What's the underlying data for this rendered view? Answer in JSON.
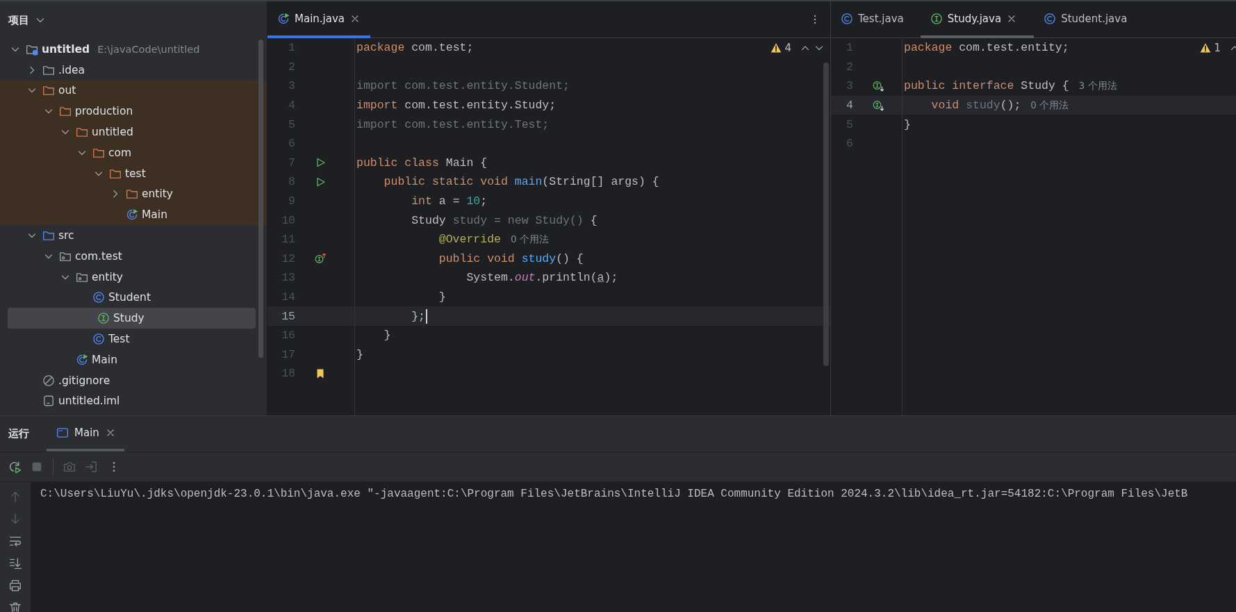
{
  "project": {
    "title": "项目",
    "tree": [
      {
        "label": "untitled",
        "path": "E:\\javaCode\\untitled",
        "kind": "project",
        "expanded": true,
        "selected": false,
        "excluded": false,
        "children": [
          {
            "label": ".idea",
            "kind": "folder",
            "expanded": false,
            "selected": false,
            "excluded": false
          },
          {
            "label": "out",
            "kind": "folder",
            "expanded": true,
            "selected": false,
            "excluded": true,
            "children": [
              {
                "label": "production",
                "kind": "folder",
                "expanded": true,
                "selected": false,
                "excluded": true,
                "children": [
                  {
                    "label": "untitled",
                    "kind": "folder",
                    "expanded": true,
                    "selected": false,
                    "excluded": true,
                    "children": [
                      {
                        "label": "com",
                        "kind": "folder",
                        "expanded": true,
                        "selected": false,
                        "excluded": true,
                        "children": [
                          {
                            "label": "test",
                            "kind": "folder",
                            "expanded": true,
                            "selected": false,
                            "excluded": true,
                            "children": [
                              {
                                "label": "entity",
                                "kind": "folder",
                                "expanded": false,
                                "selected": false,
                                "excluded": true
                              },
                              {
                                "label": "Main",
                                "kind": "main-class",
                                "selected": false,
                                "excluded": true
                              }
                            ]
                          }
                        ]
                      }
                    ]
                  }
                ]
              }
            ]
          },
          {
            "label": "src",
            "kind": "source",
            "expanded": true,
            "selected": false,
            "excluded": false,
            "children": [
              {
                "label": "com.test",
                "kind": "package",
                "expanded": true,
                "selected": false,
                "excluded": false,
                "children": [
                  {
                    "label": "entity",
                    "kind": "package",
                    "expanded": true,
                    "selected": false,
                    "excluded": false,
                    "children": [
                      {
                        "label": "Student",
                        "kind": "class",
                        "selected": false,
                        "excluded": false
                      },
                      {
                        "label": "Study",
                        "kind": "interface",
                        "selected": true,
                        "excluded": false
                      },
                      {
                        "label": "Test",
                        "kind": "class",
                        "selected": false,
                        "excluded": false
                      }
                    ]
                  },
                  {
                    "label": "Main",
                    "kind": "main-class",
                    "selected": false,
                    "excluded": false
                  }
                ]
              }
            ]
          },
          {
            "label": ".gitignore",
            "kind": "gitignore",
            "selected": false,
            "excluded": false
          },
          {
            "label": "untitled.iml",
            "kind": "iml",
            "selected": false,
            "excluded": false
          }
        ]
      }
    ]
  },
  "editors": [
    {
      "focused": true,
      "warnings": "4",
      "tabs": [
        {
          "label": "Main.java",
          "kind": "main-class",
          "selected": true
        }
      ],
      "lines": [
        {
          "number": "1",
          "kind": "plain",
          "current": false,
          "tokens": [
            {
              "text": "package ",
              "kind": "keyword"
            },
            {
              "text": "com.test;",
              "kind": "plain"
            }
          ]
        },
        {
          "number": "2",
          "kind": "plain",
          "current": false
        },
        {
          "number": "3",
          "kind": "plain",
          "current": false,
          "tokens": [
            {
              "text": "import com.test.entity.Student;",
              "kind": "unused"
            }
          ]
        },
        {
          "number": "4",
          "kind": "plain",
          "current": false,
          "tokens": [
            {
              "text": "import ",
              "kind": "keyword"
            },
            {
              "text": "com.test.entity.Study;",
              "kind": "plain"
            }
          ]
        },
        {
          "number": "5",
          "kind": "plain",
          "current": false,
          "tokens": [
            {
              "text": "import com.test.entity.Test;",
              "kind": "unused"
            }
          ]
        },
        {
          "number": "6",
          "kind": "plain",
          "current": false
        },
        {
          "number": "7",
          "kind": "run",
          "current": false,
          "tokens": [
            {
              "text": "public class ",
              "kind": "keyword"
            },
            {
              "text": "Main {",
              "kind": "plain"
            }
          ]
        },
        {
          "number": "8",
          "kind": "run",
          "current": false,
          "tokens": [
            {
              "text": "    public static void ",
              "kind": "keyword"
            },
            {
              "text": "main",
              "kind": "method"
            },
            {
              "text": "(String[] args) {",
              "kind": "plain"
            }
          ]
        },
        {
          "number": "9",
          "kind": "plain",
          "current": false,
          "tokens": [
            {
              "text": "        int ",
              "kind": "keyword"
            },
            {
              "text": "a = ",
              "kind": "plain"
            },
            {
              "text": "10",
              "kind": "number"
            },
            {
              "text": ";",
              "kind": "plain"
            }
          ]
        },
        {
          "number": "10",
          "kind": "plain",
          "current": false,
          "tokens": [
            {
              "text": "        Study",
              "kind": "plain"
            },
            {
              "text": " study = new Study() ",
              "kind": "unused"
            },
            {
              "text": "{",
              "kind": "plain"
            }
          ]
        },
        {
          "number": "11",
          "kind": "plain",
          "current": false,
          "tokens": [
            {
              "text": "            @Override",
              "kind": "annotation"
            }
          ],
          "hint": "0 个用法"
        },
        {
          "number": "12",
          "kind": "implements",
          "current": false,
          "tokens": [
            {
              "text": "            public void ",
              "kind": "keyword"
            },
            {
              "text": "study",
              "kind": "method"
            },
            {
              "text": "() {",
              "kind": "plain"
            }
          ]
        },
        {
          "number": "13",
          "kind": "plain",
          "current": false,
          "tokens": [
            {
              "text": "                System.",
              "kind": "plain"
            },
            {
              "text": "out",
              "kind": "field"
            },
            {
              "text": ".println(",
              "kind": "plain"
            },
            {
              "text": "a",
              "kind": "captured"
            },
            {
              "text": ");",
              "kind": "plain"
            }
          ]
        },
        {
          "number": "14",
          "kind": "plain",
          "current": false,
          "tokens": [
            {
              "text": "            }",
              "kind": "plain"
            }
          ]
        },
        {
          "number": "15",
          "kind": "plain",
          "current": true,
          "tokens": [
            {
              "text": "        };",
              "kind": "plain"
            }
          ]
        },
        {
          "number": "16",
          "kind": "plain",
          "current": false,
          "tokens": [
            {
              "text": "    }",
              "kind": "plain"
            }
          ]
        },
        {
          "number": "17",
          "kind": "plain",
          "current": false,
          "tokens": [
            {
              "text": "}",
              "kind": "plain"
            }
          ]
        },
        {
          "number": "18",
          "kind": "bookmark",
          "current": false
        }
      ]
    },
    {
      "focused": false,
      "warnings": "1",
      "tabs": [
        {
          "label": "Test.java",
          "kind": "class",
          "selected": false
        },
        {
          "label": "Study.java",
          "kind": "interface",
          "selected": true
        },
        {
          "label": "Student.java",
          "kind": "class",
          "selected": false
        }
      ],
      "lines": [
        {
          "number": "1",
          "kind": "plain",
          "current": false,
          "tokens": [
            {
              "text": "package ",
              "kind": "keyword"
            },
            {
              "text": "com.test.entity;",
              "kind": "plain"
            }
          ]
        },
        {
          "number": "2",
          "kind": "plain",
          "current": false
        },
        {
          "number": "3",
          "kind": "implemented",
          "current": false,
          "tokens": [
            {
              "text": "public interface ",
              "kind": "keyword"
            },
            {
              "text": "Study {",
              "kind": "plain"
            }
          ],
          "hint": "3 个用法"
        },
        {
          "number": "4",
          "kind": "implemented",
          "current": true,
          "tokens": [
            {
              "text": "    void ",
              "kind": "keyword"
            },
            {
              "text": "study",
              "kind": "unused"
            },
            {
              "text": "();",
              "kind": "plain"
            }
          ],
          "hint": "0 个用法"
        },
        {
          "number": "5",
          "kind": "plain",
          "current": false,
          "tokens": [
            {
              "text": "}",
              "kind": "plain"
            }
          ]
        },
        {
          "number": "6",
          "kind": "plain",
          "current": false
        }
      ]
    }
  ],
  "run_panel": {
    "title": "运行",
    "tabs": [
      {
        "label": "Main",
        "selected": true
      }
    ],
    "toolbar": [
      {
        "kind": "rerun",
        "disabled": false
      },
      {
        "kind": "stop",
        "disabled": true
      },
      {
        "kind": "camera",
        "disabled": true
      },
      {
        "kind": "exit",
        "disabled": true
      },
      {
        "kind": "more",
        "disabled": false
      }
    ],
    "side_tools": [
      {
        "kind": "up",
        "disabled": true
      },
      {
        "kind": "down",
        "disabled": true
      },
      {
        "kind": "wrap",
        "disabled": false
      },
      {
        "kind": "scroll-end",
        "disabled": false
      },
      {
        "kind": "print",
        "disabled": false
      },
      {
        "kind": "trash",
        "disabled": false
      }
    ],
    "output": [
      "C:\\Users\\LiuYu\\.jdks\\openjdk-23.0.1\\bin\\java.exe \"-javaagent:C:\\Program Files\\JetBrains\\IntelliJ IDEA Community Edition 2024.3.2\\lib\\idea_rt.jar=54182:C:\\Program Files\\JetB"
    ]
  }
}
